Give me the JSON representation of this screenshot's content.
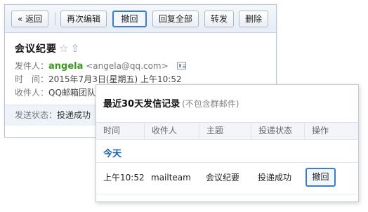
{
  "toolbar": {
    "back_label": "« 返回",
    "resend_label": "再次编辑",
    "recall_label": "撤回",
    "reply_all_label": "回复全部",
    "forward_label": "转发",
    "delete_label": "删除"
  },
  "mail": {
    "subject": "会议纪要",
    "star_icon": "☆",
    "flag_icon": "⇧",
    "sender_label": "发件人：",
    "sender_name": "angela",
    "sender_email": "<angela@qq.com>",
    "time_label": "时　间：",
    "time_value": "2015年7月3日(星期五) 上午10:52",
    "recipient_label": "收件人：",
    "recipient_value": "QQ邮箱团队",
    "status_label": "发送状态：",
    "status_value": "投递成功"
  },
  "popup": {
    "title": "最近30天发信记录",
    "title_note": "(不包含群邮件)",
    "columns": [
      "时间",
      "收件人",
      "主题",
      "投递状态",
      "操作"
    ],
    "group_label": "今天",
    "rows": [
      {
        "time": "上午10:52",
        "recipient": "mailteam",
        "subject": "会议纪要",
        "status": "投递成功",
        "action": "撤回"
      }
    ]
  },
  "colors": {
    "accent_blue": "#3d7ec6",
    "group_blue": "#1a5fb4",
    "sender_green": "#3a9a1c",
    "toolbar_bg": "#e6edf6"
  }
}
